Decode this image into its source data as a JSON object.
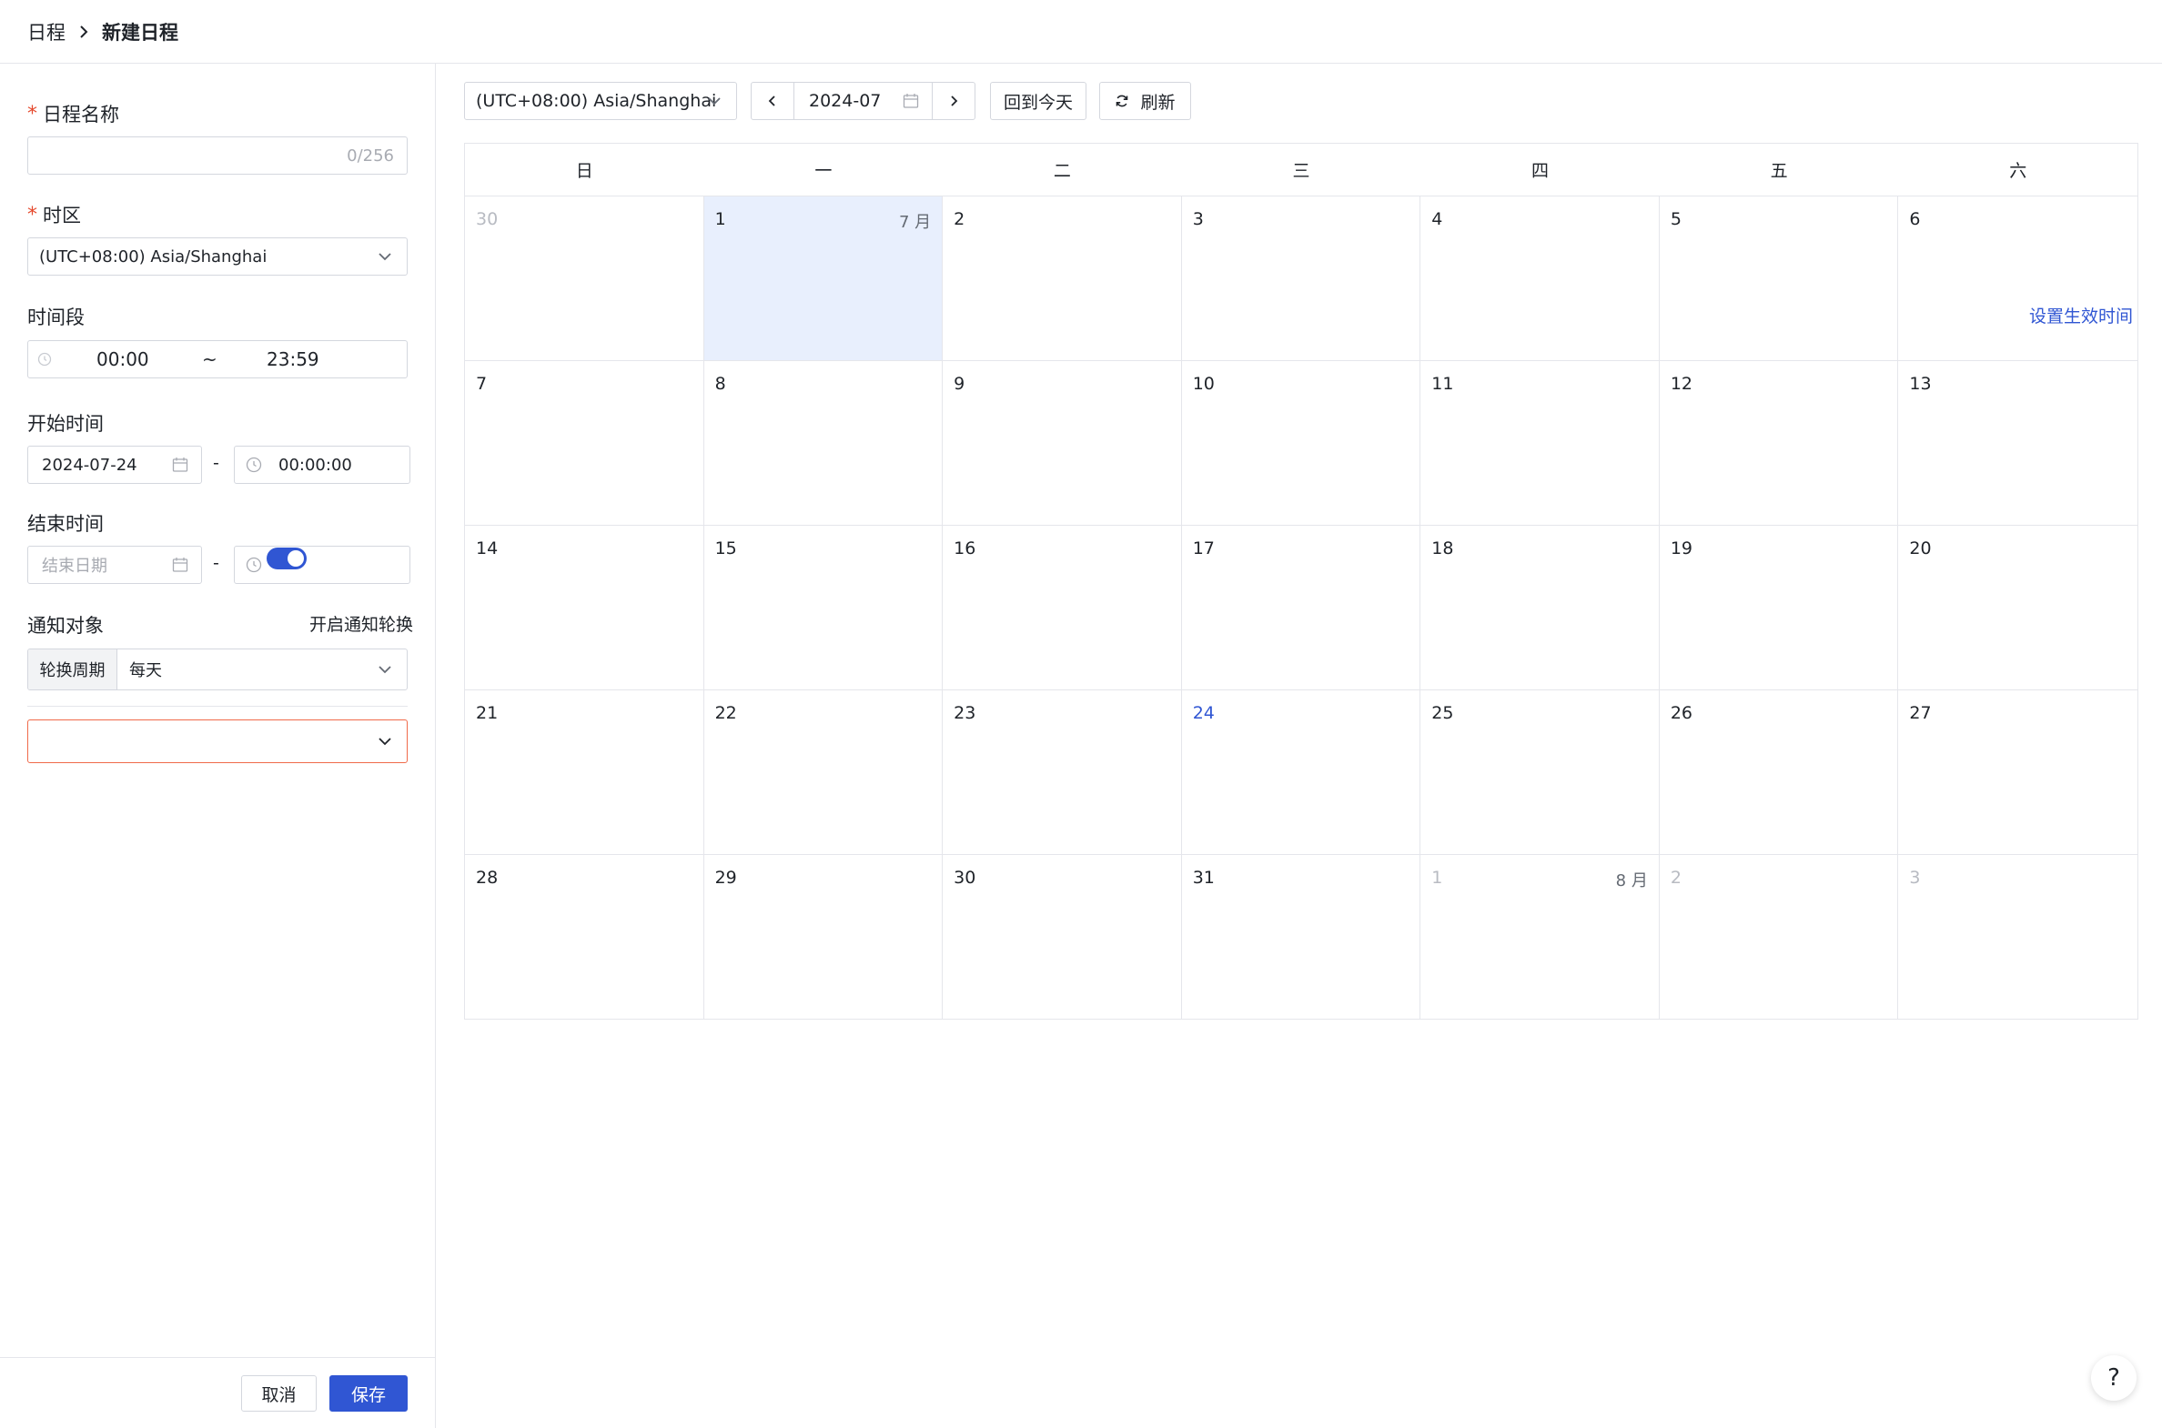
{
  "breadcrumb": {
    "parent": "日程",
    "current": "新建日程"
  },
  "form": {
    "name": {
      "label": "日程名称",
      "value": "",
      "counter": "0/256"
    },
    "timezone": {
      "label": "时区",
      "value": "(UTC+08:00) Asia/Shanghai"
    },
    "time_range": {
      "label": "时间段",
      "link": "设置生效时间",
      "start": "00:00",
      "separator": "~",
      "end": "23:59"
    },
    "start_time": {
      "label": "开始时间",
      "date": "2024-07-24",
      "separator": "-",
      "time": "00:00:00"
    },
    "end_time": {
      "label": "结束时间",
      "date_placeholder": "结束日期",
      "separator": "-",
      "time": ""
    },
    "notify": {
      "label": "通知对象",
      "toggle_label": "开启通知轮换",
      "toggle_on": true
    },
    "rotation": {
      "label": "轮换周期",
      "value": "每天"
    },
    "target_select": {
      "value": ""
    }
  },
  "footer": {
    "cancel": "取消",
    "save": "保存"
  },
  "toolbar": {
    "timezone": "(UTC+08:00) Asia/Shanghai",
    "month": "2024-07",
    "today": "回到今天",
    "refresh": "刷新"
  },
  "calendar": {
    "weekdays": [
      "日",
      "一",
      "二",
      "三",
      "四",
      "五",
      "六"
    ],
    "days": [
      {
        "d": "30",
        "other": true
      },
      {
        "d": "1",
        "mon": "7 月",
        "selected": true
      },
      {
        "d": "2"
      },
      {
        "d": "3"
      },
      {
        "d": "4"
      },
      {
        "d": "5"
      },
      {
        "d": "6"
      },
      {
        "d": "7"
      },
      {
        "d": "8"
      },
      {
        "d": "9"
      },
      {
        "d": "10"
      },
      {
        "d": "11"
      },
      {
        "d": "12"
      },
      {
        "d": "13"
      },
      {
        "d": "14"
      },
      {
        "d": "15"
      },
      {
        "d": "16"
      },
      {
        "d": "17"
      },
      {
        "d": "18"
      },
      {
        "d": "19"
      },
      {
        "d": "20"
      },
      {
        "d": "21"
      },
      {
        "d": "22"
      },
      {
        "d": "23"
      },
      {
        "d": "24",
        "today": true
      },
      {
        "d": "25"
      },
      {
        "d": "26"
      },
      {
        "d": "27"
      },
      {
        "d": "28"
      },
      {
        "d": "29"
      },
      {
        "d": "30"
      },
      {
        "d": "31"
      },
      {
        "d": "1",
        "mon": "8 月",
        "other": true
      },
      {
        "d": "2",
        "other": true
      },
      {
        "d": "3",
        "other": true
      }
    ]
  },
  "help": "?",
  "colors": {
    "primary": "#3056d3",
    "selected_bg": "#e8effd",
    "required": "#e5492d",
    "error_border": "#f06a4a"
  }
}
